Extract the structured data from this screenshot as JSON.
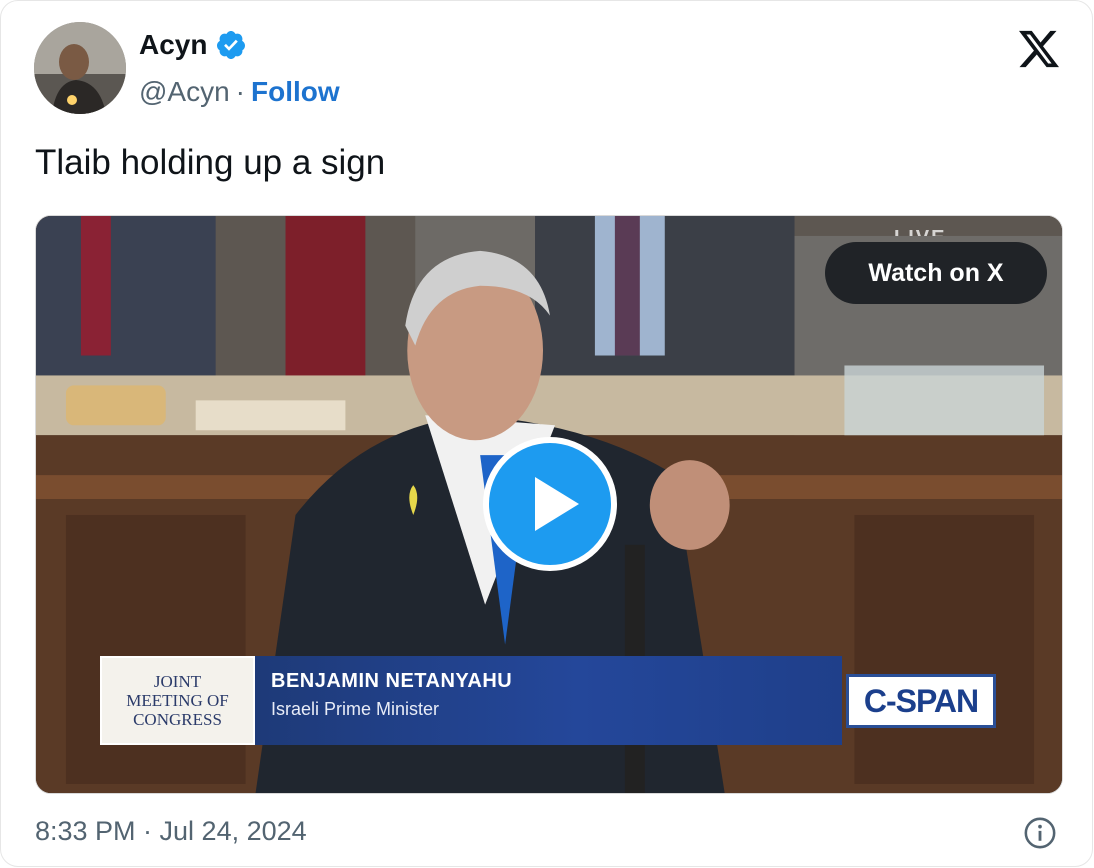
{
  "author": {
    "display_name": "Acyn",
    "handle": "@Acyn",
    "separator": "·",
    "follow_label": "Follow",
    "verified": true
  },
  "platform_icon": "x-logo-icon",
  "tweet": {
    "text": "Tlaib holding up a sign",
    "timestamp": "8:33 PM · Jul 24, 2024"
  },
  "media": {
    "watch_label": "Watch on X",
    "live_badge": "LIVE",
    "chyron": {
      "left_lines": [
        "JOINT",
        "MEETING OF",
        "CONGRESS"
      ],
      "name": "BENJAMIN NETANYAHU",
      "title": "Israeli Prime Minister",
      "network": "C-SPAN"
    }
  },
  "colors": {
    "accent_blue": "#1d9bf0",
    "follow_blue": "#1d73cf",
    "muted_text": "#536471"
  }
}
